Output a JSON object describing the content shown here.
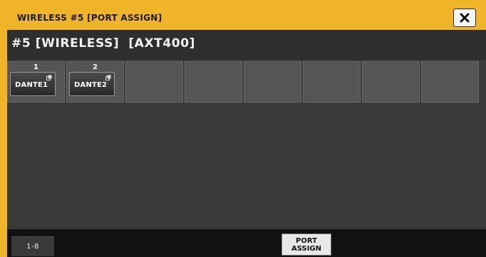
{
  "window": {
    "title": "WIRELESS #5 [PORT ASSIGN]",
    "close_icon": "close-icon"
  },
  "header": {
    "channel_title": "#5 [WIRELESS]  [AXT400]"
  },
  "slots": [
    {
      "number": "1",
      "port": "DANTE1"
    },
    {
      "number": "2",
      "port": "DANTE2"
    },
    {
      "number": "",
      "port": ""
    },
    {
      "number": "",
      "port": ""
    },
    {
      "number": "",
      "port": ""
    },
    {
      "number": "",
      "port": ""
    },
    {
      "number": "",
      "port": ""
    },
    {
      "number": "",
      "port": ""
    }
  ],
  "footer": {
    "range_tab": "1-8",
    "port_assign_line1": "PORT",
    "port_assign_line2": "ASSIGN"
  },
  "colors": {
    "title_bar": "#f0b429",
    "panel": "#3a3a3a",
    "slot": "#555555"
  }
}
